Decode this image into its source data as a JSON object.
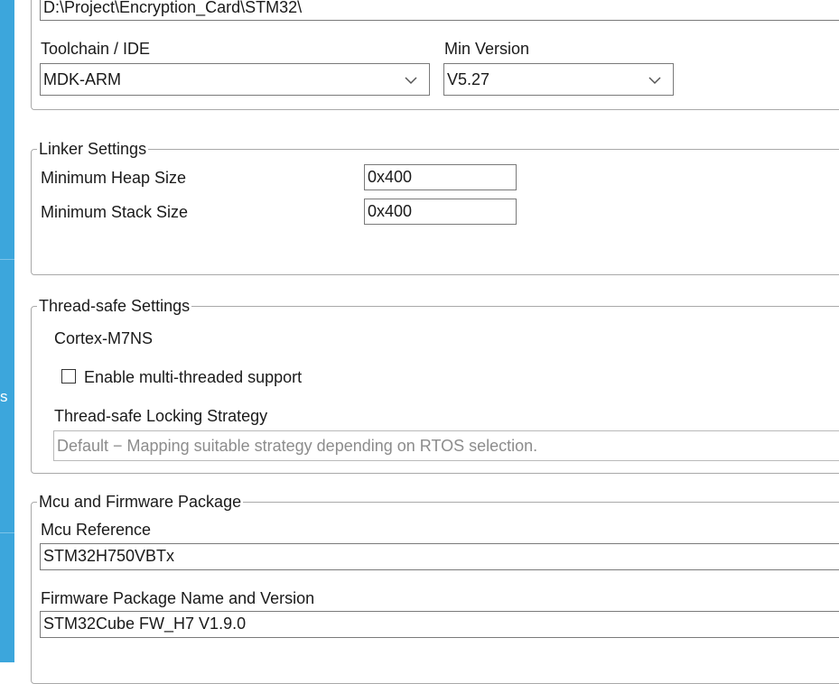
{
  "project": {
    "location_value": "D:\\Project\\Encryption_Card\\STM32\\",
    "toolchain_label": "Toolchain / IDE",
    "toolchain_value": "MDK-ARM",
    "min_version_label": "Min Version",
    "min_version_value": "V5.27"
  },
  "linker": {
    "title": "Linker Settings",
    "heap_label": "Minimum Heap Size",
    "heap_value": "0x400",
    "stack_label": "Minimum Stack Size",
    "stack_value": "0x400"
  },
  "thread_safe": {
    "title": "Thread-safe Settings",
    "core": "Cortex-M7NS",
    "multithread_label": "Enable multi-threaded support",
    "multithread_checked": false,
    "strategy_label": "Thread-safe Locking Strategy",
    "strategy_value": "Default  −  Mapping suitable strategy depending on RTOS selection."
  },
  "mcu": {
    "title": "Mcu and Firmware Package",
    "reference_label": "Mcu Reference",
    "reference_value": "STM32H750VBTx",
    "firmware_label": "Firmware Package Name and Version",
    "firmware_value": "STM32Cube FW_H7 V1.9.0"
  },
  "sidebar": {
    "partial_tab_text": "s"
  },
  "icons": {
    "dropdown": "chevron-down-icon"
  },
  "colors": {
    "sidebar": "#3ca6dc",
    "border": "#a9a9a9",
    "disabled_text": "#8c8c8c"
  }
}
